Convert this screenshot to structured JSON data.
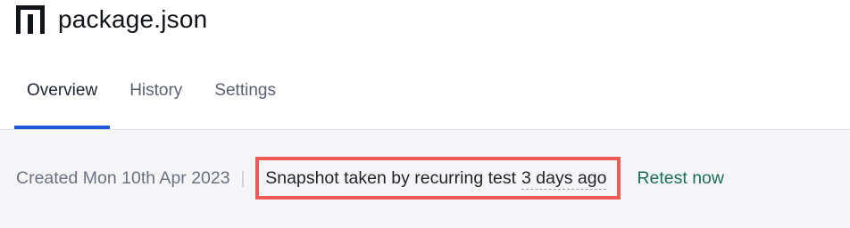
{
  "header": {
    "icon": "npm-logo-icon",
    "title": "package.json"
  },
  "tabs": [
    {
      "label": "Overview",
      "active": true
    },
    {
      "label": "History",
      "active": false
    },
    {
      "label": "Settings",
      "active": false
    }
  ],
  "meta": {
    "created": "Created Mon 10th Apr 2023",
    "separator": "|",
    "snapshot_text": "Snapshot taken by recurring test",
    "time_ago": "3 days ago",
    "retest_label": "Retest now"
  },
  "colors": {
    "active_tab_indicator": "#1f5bd6",
    "highlight_border": "#ef5b52",
    "retest_link": "#1b6e54"
  }
}
